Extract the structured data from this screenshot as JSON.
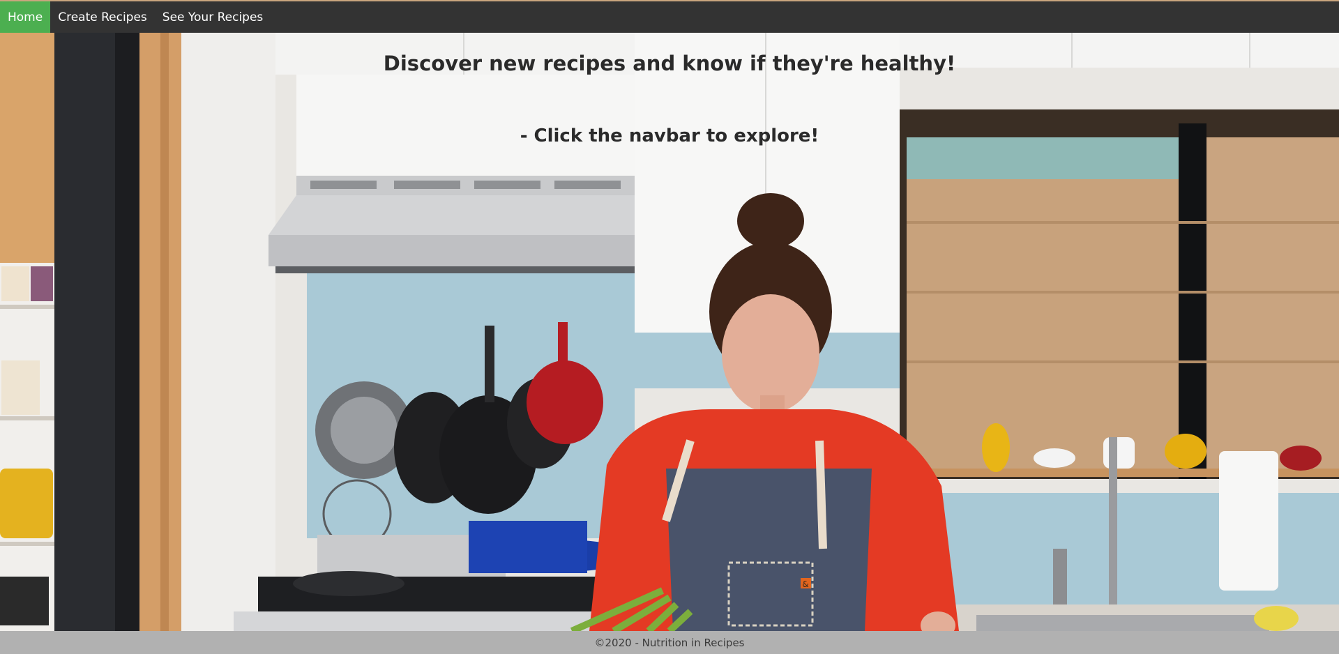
{
  "navbar": {
    "items": [
      {
        "label": "Home",
        "active": true
      },
      {
        "label": "Create Recipes",
        "active": false
      },
      {
        "label": "See Your Recipes",
        "active": false
      }
    ]
  },
  "hero": {
    "headline": "Discover new recipes and know if they're healthy!",
    "subheadline": "- Click the navbar to explore!"
  },
  "footer": {
    "text": "©2020 - Nutrition in Recipes"
  },
  "colors": {
    "navbar_bg": "#333333",
    "active_tab": "#4caf50",
    "footer_bg": "#c8c8c8"
  },
  "icons": {
    "apron_badge": "&"
  }
}
